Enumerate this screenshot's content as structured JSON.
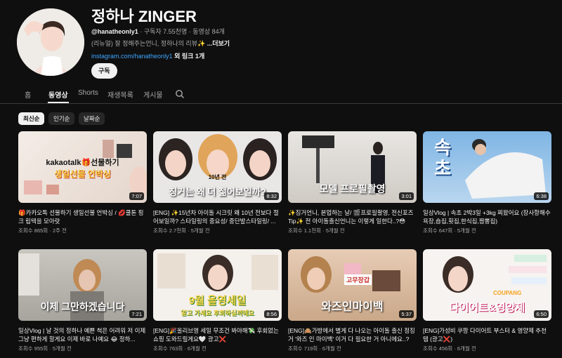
{
  "channel": {
    "name": "정하나 ZINGER",
    "handle": "@hanatheonly1",
    "subscribers": "구독자 7.55천명",
    "video_count": "동영상 84개",
    "description": "(리뉴얼) 잘 정해주는언니, 정하나의 리뷰✨",
    "more_label": "...더보기",
    "link": "instagram.com/hanatheonly1",
    "link_extra": "외 링크 1개",
    "subscribe_label": "구독"
  },
  "tabs": [
    {
      "label": "홈"
    },
    {
      "label": "동영상"
    },
    {
      "label": "Shorts"
    },
    {
      "label": "재생목록"
    },
    {
      "label": "게시물"
    }
  ],
  "chips": [
    {
      "label": "최신순"
    },
    {
      "label": "인기순"
    },
    {
      "label": "날짜순"
    }
  ],
  "videos": [
    {
      "title": "🎁카카오톡 선물하기 생일선물 언박싱 / 💋쿨톤 핑크 립텍을 모아랏",
      "views": "조회수 865회",
      "age": "2주 전",
      "duration": "7:07",
      "overlay_top": "kakaotalk🎁선물하기",
      "overlay_bottom": "생일선물 언박싱"
    },
    {
      "title": "[ENG] ✨15년차 아이돌 시크릿 왜 10년 전보다 절어보일까? 스타일링의 중요성/ 중단발스타일링/ ...",
      "views": "조회수 2.7천회",
      "age": "5개월 전",
      "duration": "8:32",
      "overlay_top": "10년 전",
      "overlay_bottom": "징거는 왜 더 젊어보일까?"
    },
    {
      "title": "✨징거언니, 본업하는 날/ 🎬프로필촬영, 전신포즈 Tip✨ 전 아이돌출신언니는 이렇게 일한다..?😳",
      "views": "조회수 1.1천회",
      "age": "5개월 전",
      "duration": "3:01",
      "overlay_top": "",
      "overlay_bottom": "모델 프로필촬영"
    },
    {
      "title": "일상Vlog | 속초 2박3일 +3kg 찌왔어요 (장사항해수욕장,숍집,횟집,한식집,짬뽕집)",
      "views": "조회수 647회",
      "age": "5개월 전",
      "duration": "6:38",
      "overlay_top": "속초",
      "overlay_bottom": ""
    },
    {
      "title": "일상Vlog | 날 것의 정하나 예쁜 척은 어려워 저 이제 그냥 편하게 할게요 이제 바로 나예요 😂 정하...",
      "views": "조회수 955회",
      "age": "5개월 전",
      "duration": "7:21",
      "overlay_top": "",
      "overlay_bottom": "이제 그만하겠습니다"
    },
    {
      "title": "[ENG]🎉올리브영 세일 무조건 봐야해💸 후회없는 쇼핑 도와드릴게요🤍 광고❌",
      "views": "조회수 763회",
      "age": "6개월 전",
      "duration": "8:56",
      "overlay_top": "9월 올영세일",
      "overlay_bottom": "알고 가세요 후회하실꺼에요"
    },
    {
      "title": "[ENG]🙈가방에서 별게 다 나오는 아이돌 출신 정징거 '와즈 인 마이백' 이거 다 필요한 거 아니에요..?",
      "views": "조회수 719회",
      "age": "6개월 전",
      "duration": "5:37",
      "overlay_top": "고무장갑",
      "overlay_bottom": "와즈인마이백"
    },
    {
      "title": "[ENG]가성비 쿠팡 다이어트 부스터 & 영양제 추천템 (광고❌)",
      "views": "조회수 456회",
      "age": "6개월 전",
      "duration": "6:50",
      "overlay_top": "COUPANG",
      "overlay_bottom": "다이어트&영양제"
    }
  ],
  "icons": {
    "search": "search-icon"
  },
  "colors": {
    "background": "#0f0f0f",
    "link": "#3ea6ff",
    "chip_active": "#f1f1f1"
  }
}
